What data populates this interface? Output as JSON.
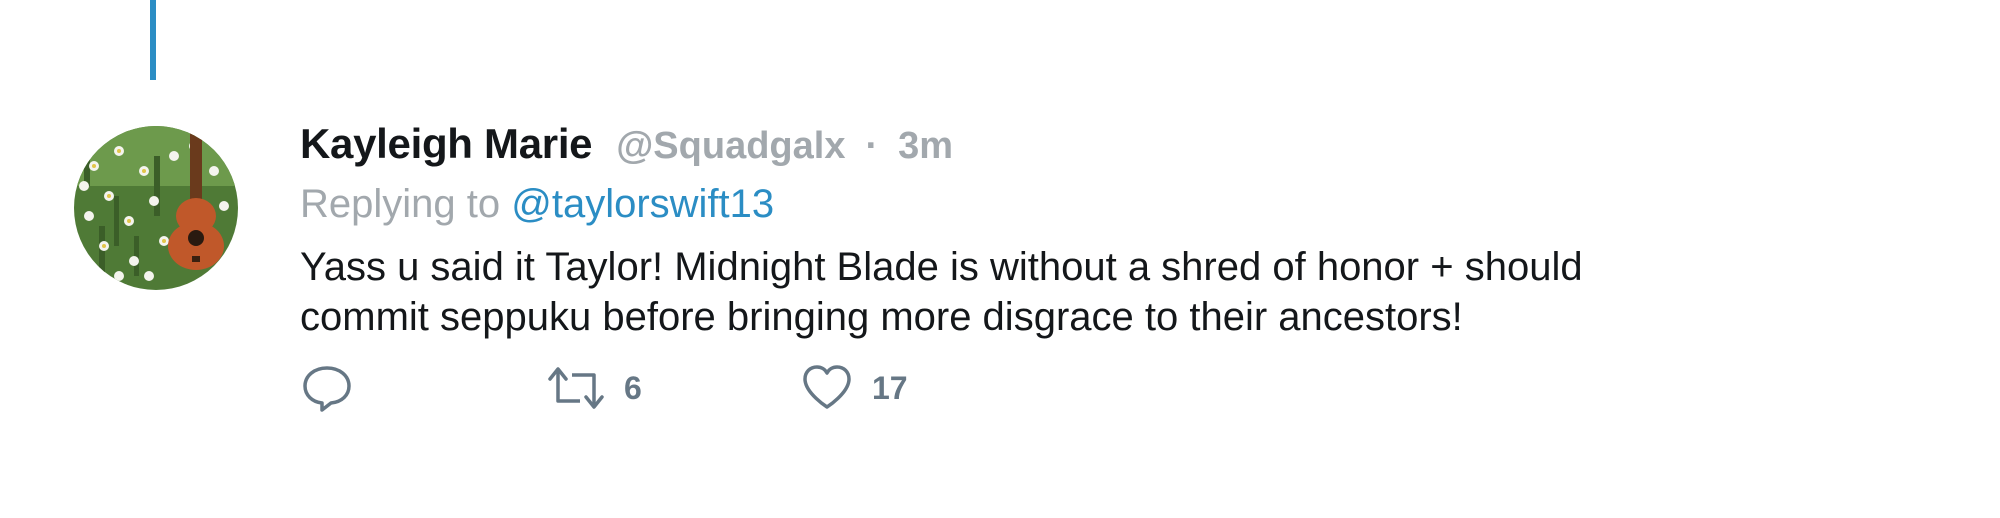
{
  "tweet": {
    "display_name": "Kayleigh Marie",
    "handle": "@Squadgalx",
    "separator": "·",
    "time": "3m",
    "replying_prefix": "Replying to",
    "replying_to": "@taylorswift13",
    "text_line1": "Yass u said it Taylor! Midnight Blade is without a shred of honor + should",
    "text_line2": "commit seppuku before bringing more disgrace to their ancestors!"
  },
  "actions": {
    "reply_icon": "reply-icon",
    "retweet_icon": "retweet-icon",
    "retweet_count": "6",
    "like_icon": "heart-icon",
    "like_count": "17"
  },
  "colors": {
    "thread_line": "#2b8dc4",
    "mention": "#2b8dc4",
    "muted": "#a2a8ad",
    "icon": "#667785",
    "text": "#14171a"
  }
}
